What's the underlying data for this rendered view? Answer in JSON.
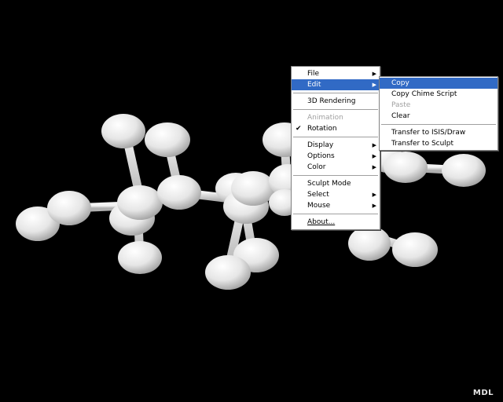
{
  "viewer": {
    "background": "#000000",
    "atom_color": "#e8e8e8",
    "brand": "MDL"
  },
  "main_menu": {
    "items": [
      {
        "label": "File",
        "submenu": true
      },
      {
        "label": "Edit",
        "submenu": true,
        "highlighted": true
      },
      {
        "separator": true
      },
      {
        "label": "3D Rendering"
      },
      {
        "separator": true
      },
      {
        "label": "Animation",
        "disabled": true
      },
      {
        "label": "Rotation",
        "checked": true
      },
      {
        "separator": true
      },
      {
        "label": "Display",
        "submenu": true
      },
      {
        "label": "Options",
        "submenu": true
      },
      {
        "label": "Color",
        "submenu": true
      },
      {
        "separator": true
      },
      {
        "label": "Sculpt Mode"
      },
      {
        "label": "Select",
        "submenu": true
      },
      {
        "label": "Mouse",
        "submenu": true
      },
      {
        "separator": true
      },
      {
        "label": "About..."
      }
    ]
  },
  "edit_submenu": {
    "items": [
      {
        "label": "Copy",
        "highlighted": true
      },
      {
        "label": "Copy Chime Script"
      },
      {
        "label": "Paste",
        "disabled": true
      },
      {
        "label": "Clear"
      },
      {
        "separator": true
      },
      {
        "label": "Transfer to ISIS/Draw"
      },
      {
        "label": "Transfer to Sculpt"
      }
    ]
  },
  "colors": {
    "menu_bg": "#ffffff",
    "highlight": "#316ac5",
    "disabled_text": "#a0a0a0"
  }
}
